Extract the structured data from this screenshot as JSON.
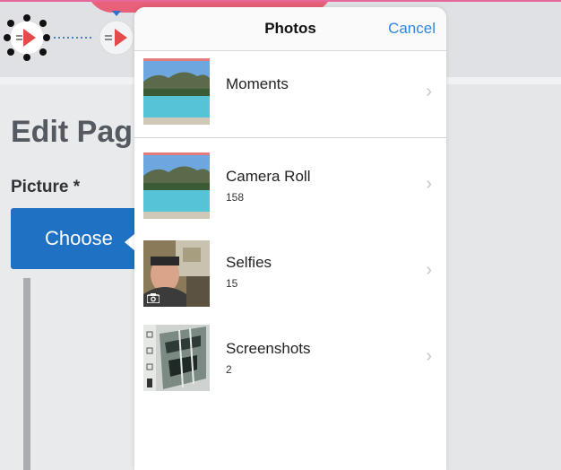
{
  "page": {
    "heading": "Edit Pag",
    "picture_label": "Picture *",
    "choose_button": "Choose"
  },
  "popover": {
    "title": "Photos",
    "cancel_label": "Cancel",
    "albums": [
      {
        "title": "Moments",
        "count": ""
      },
      {
        "title": "Camera Roll",
        "count": "158"
      },
      {
        "title": "Selfies",
        "count": "15"
      },
      {
        "title": "Screenshots",
        "count": "2"
      }
    ],
    "chevron": "›"
  },
  "colors": {
    "accent_blue": "#2f86e0",
    "button_blue": "#1f71c4",
    "brand_pink": "#e8607a",
    "workflow_red": "#e14b4b"
  },
  "icons": [
    "workflow-node-icon",
    "camera-icon",
    "chevron-right-icon"
  ]
}
